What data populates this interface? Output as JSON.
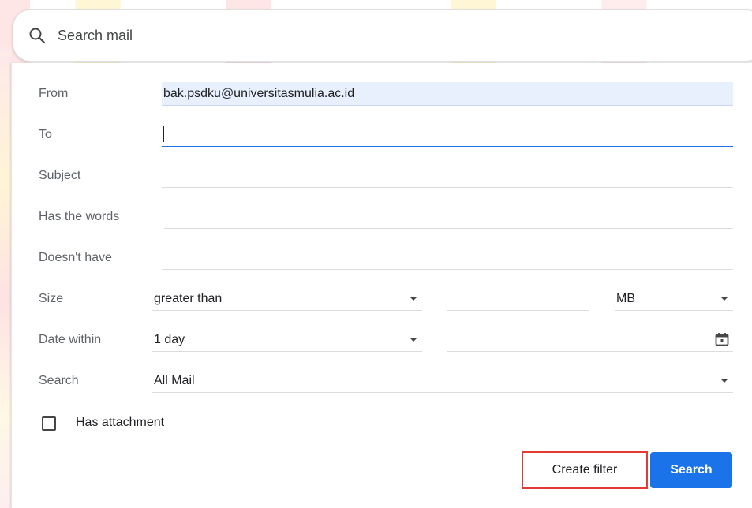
{
  "search": {
    "placeholder": "Search mail"
  },
  "form": {
    "from": {
      "label": "From",
      "value": "bak.psdku@universitasmulia.ac.id"
    },
    "to": {
      "label": "To",
      "value": ""
    },
    "subject": {
      "label": "Subject",
      "value": ""
    },
    "has_words": {
      "label": "Has the words",
      "value": ""
    },
    "doesnt_have": {
      "label": "Doesn't have",
      "value": ""
    },
    "size": {
      "label": "Size",
      "operator": "greater than",
      "value": "",
      "unit": "MB"
    },
    "date_within": {
      "label": "Date within",
      "value": "1 day",
      "date": ""
    },
    "search_in": {
      "label": "Search",
      "value": "All Mail"
    },
    "has_attachment": {
      "label": "Has attachment",
      "checked": false
    }
  },
  "actions": {
    "create_filter": "Create filter",
    "search": "Search"
  },
  "colors": {
    "accent": "#1a73e8",
    "highlight": "#e53935",
    "autofill": "#e8f0fe"
  }
}
